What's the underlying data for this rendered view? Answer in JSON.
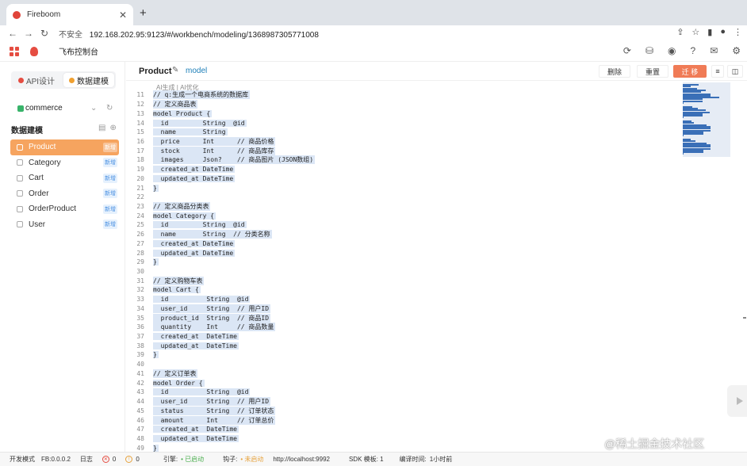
{
  "browser": {
    "tab_title": "Fireboom",
    "tab_close": "✕",
    "new_tab": "+",
    "insecure_label": "不安全",
    "url": "192.168.202.95:9123/#/workbench/modeling/1368987305771008",
    "nav_back": "←",
    "nav_forward": "→",
    "nav_reload": "↻"
  },
  "app": {
    "title": "飞布控制台"
  },
  "sidebar": {
    "tabs": [
      {
        "label": "API设计",
        "color": "#e54d42"
      },
      {
        "label": "数据建模",
        "color": "#f0a030"
      }
    ],
    "datasource": "commerce",
    "section_title": "数据建模",
    "models": [
      {
        "name": "Product",
        "badge": "新增"
      },
      {
        "name": "Category",
        "badge": "新增"
      },
      {
        "name": "Cart",
        "badge": "新增"
      },
      {
        "name": "Order",
        "badge": "新增"
      },
      {
        "name": "OrderProduct",
        "badge": "新增"
      },
      {
        "name": "User",
        "badge": "新增"
      }
    ]
  },
  "main": {
    "model_name": "Product",
    "model_type": "model",
    "delete_label": "删除",
    "reset_label": "重置",
    "migrate_label": "迁 移",
    "ai_bar": "AI生成 | AI优化"
  },
  "code": [
    {
      "n": "11",
      "t": "// q:生成一个电商系统的数据库"
    },
    {
      "n": "12",
      "t": "// 定义商品表"
    },
    {
      "n": "13",
      "t": "model Product {"
    },
    {
      "n": "14",
      "t": "  id         String  @id"
    },
    {
      "n": "15",
      "t": "  name       String"
    },
    {
      "n": "16",
      "t": "  price      Int      // 商品价格"
    },
    {
      "n": "17",
      "t": "  stock      Int      // 商品库存"
    },
    {
      "n": "18",
      "t": "  images     Json?    // 商品图片 (JSON数组)"
    },
    {
      "n": "19",
      "t": "  created_at DateTime"
    },
    {
      "n": "20",
      "t": "  updated_at DateTime"
    },
    {
      "n": "21",
      "t": "}"
    },
    {
      "n": "22",
      "t": ""
    },
    {
      "n": "23",
      "t": "// 定义商品分类表"
    },
    {
      "n": "24",
      "t": "model Category {"
    },
    {
      "n": "25",
      "t": "  id         String  @id"
    },
    {
      "n": "26",
      "t": "  name       String  // 分类名称"
    },
    {
      "n": "27",
      "t": "  created_at DateTime"
    },
    {
      "n": "28",
      "t": "  updated_at DateTime"
    },
    {
      "n": "29",
      "t": "}"
    },
    {
      "n": "30",
      "t": ""
    },
    {
      "n": "31",
      "t": "// 定义购物车表"
    },
    {
      "n": "32",
      "t": "model Cart {"
    },
    {
      "n": "33",
      "t": "  id          String  @id"
    },
    {
      "n": "34",
      "t": "  user_id     String  // 用户ID"
    },
    {
      "n": "35",
      "t": "  product_id  String  // 商品ID"
    },
    {
      "n": "36",
      "t": "  quantity    Int     // 商品数量"
    },
    {
      "n": "37",
      "t": "  created_at  DateTime"
    },
    {
      "n": "38",
      "t": "  updated_at  DateTime"
    },
    {
      "n": "39",
      "t": "}"
    },
    {
      "n": "40",
      "t": ""
    },
    {
      "n": "41",
      "t": "// 定义订单表"
    },
    {
      "n": "42",
      "t": "model Order {"
    },
    {
      "n": "43",
      "t": "  id          String  @id"
    },
    {
      "n": "44",
      "t": "  user_id     String  // 用户ID"
    },
    {
      "n": "45",
      "t": "  status      String  // 订单状态"
    },
    {
      "n": "46",
      "t": "  amount      Int     // 订单总价"
    },
    {
      "n": "47",
      "t": "  created_at  DateTime"
    },
    {
      "n": "48",
      "t": "  updated_at  DateTime"
    },
    {
      "n": "49",
      "t": "}"
    }
  ],
  "status": {
    "mode": "开发模式",
    "version": "FB:0.0.0.2",
    "log": "日志",
    "errors": "0",
    "warnings": "0",
    "engine_label": "引擎:",
    "engine_status": "• 已启动",
    "hook_label": "钩子:",
    "hook_status": "• 未启动",
    "endpoint": "http://localhost:9992",
    "sdk_label": "SDK 模板: 1",
    "compile_label": "编译时间:",
    "compile_time": "1小时前"
  },
  "watermark": "@稀土掘金技术社区",
  "colors": {
    "accent": "#f07b56",
    "active_model": "#f6a45f",
    "code_highlight": "#dbe6f5",
    "link": "#1e7fb8"
  }
}
